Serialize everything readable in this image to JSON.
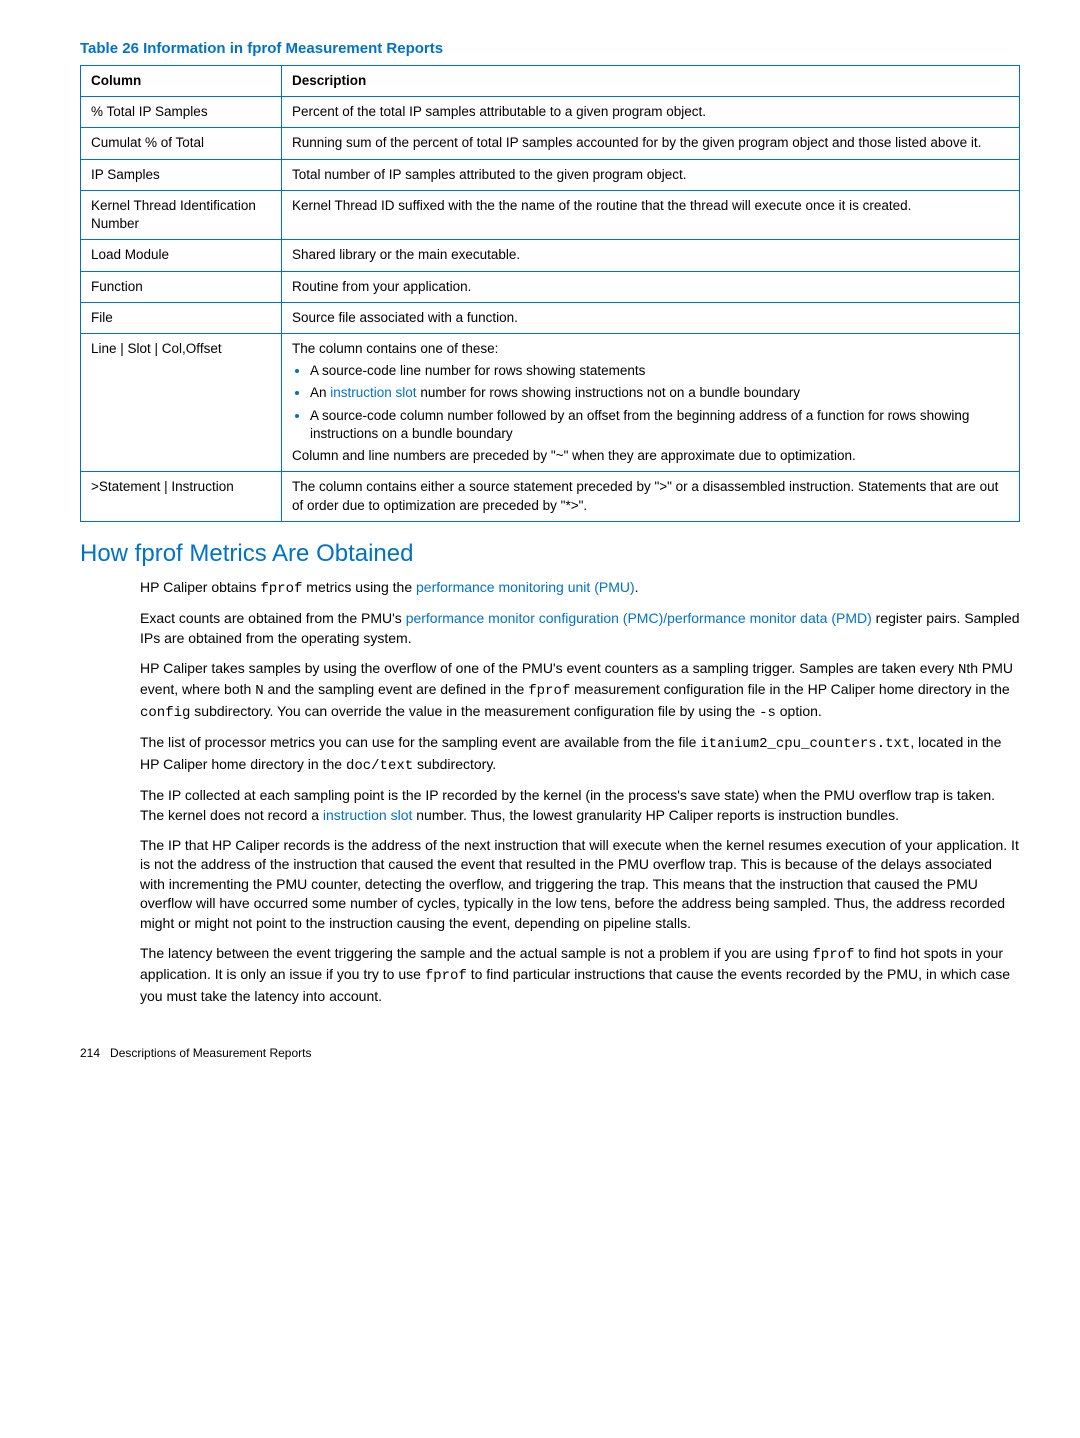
{
  "table": {
    "title": "Table 26 Information in fprof Measurement Reports",
    "headers": {
      "col1": "Column",
      "col2": "Description"
    },
    "rows": {
      "r1": {
        "c1": "% Total IP Samples",
        "c2": "Percent of the total IP samples attributable to a given program object."
      },
      "r2": {
        "c1": "Cumulat % of Total",
        "c2": "Running sum of the percent of total IP samples accounted for by the given program object and those listed above it."
      },
      "r3": {
        "c1": "IP Samples",
        "c2": "Total number of IP samples attributed to the given program object."
      },
      "r4": {
        "c1": "Kernel Thread Identification Number",
        "c2": "Kernel Thread ID suffixed with the the name of the routine that the thread will execute once it is created."
      },
      "r5": {
        "c1": "Load Module",
        "c2": "Shared library or the main executable."
      },
      "r6": {
        "c1": "Function",
        "c2": "Routine from your application."
      },
      "r7": {
        "c1": "File",
        "c2": "Source file associated with a function."
      },
      "r8": {
        "c1": "Line | Slot | Col,Offset",
        "intro": "The column contains one of these:",
        "b1": "A source-code line number for rows showing statements",
        "b2a": "An ",
        "b2link": "instruction slot",
        "b2b": " number for rows showing instructions not on a bundle boundary",
        "b3": "A source-code column number followed by an offset from the beginning address of a function for rows showing instructions on a bundle boundary",
        "outro": "Column and line numbers are preceded by \"~\" when they are approximate due to optimization."
      },
      "r9": {
        "c1": ">Statement | Instruction",
        "c2": "The column contains either a source statement preceded by \">\" or a disassembled instruction. Statements that are out of order due to optimization are preceded by \"*>\"."
      }
    }
  },
  "section": {
    "heading": "How fprof Metrics Are Obtained",
    "p1": {
      "a": "HP Caliper obtains ",
      "code": "fprof",
      "b": " metrics using the ",
      "link": "performance monitoring unit (PMU)",
      "c": "."
    },
    "p2": {
      "a": "Exact counts are obtained from the PMU's ",
      "link": "performance monitor configuration (PMC)/performance monitor data (PMD)",
      "b": " register pairs. Sampled IPs are obtained from the operating system."
    },
    "p3": {
      "a": "HP Caliper takes samples by using the overflow of one of the PMU's event counters as a sampling trigger. Samples are taken every ",
      "code1": "N",
      "b": "th PMU event, where both ",
      "code2": "N",
      "c": " and the sampling event are defined in the ",
      "code3": "fprof",
      "d": " measurement configuration file in the HP Caliper home directory in the ",
      "code4": "config",
      "e": " subdirectory. You can override the value in the measurement configuration file by using the ",
      "code5": "-s",
      "f": " option."
    },
    "p4": {
      "a": "The list of processor metrics you can use for the sampling event are available from the file ",
      "code1": "itanium2_cpu_counters.txt",
      "b": ", located in the HP Caliper home directory in the ",
      "code2": "doc/text",
      "c": " subdirectory."
    },
    "p5": {
      "a": "The IP collected at each sampling point is the IP recorded by the kernel (in the process's save state) when the PMU overflow trap is taken. The kernel does not record a ",
      "link": "instruction slot",
      "b": " number. Thus, the lowest granularity HP Caliper reports is instruction bundles."
    },
    "p6": "The IP that HP Caliper records is the address of the next instruction that will execute when the kernel resumes execution of your application. It is not the address of the instruction that caused the event that resulted in the PMU overflow trap. This is because of the delays associated with incrementing the PMU counter, detecting the overflow, and triggering the trap. This means that the instruction that caused the PMU overflow will have occurred some number of cycles, typically in the low tens, before the address being sampled. Thus, the address recorded might or might not point to the instruction causing the event, depending on pipeline stalls.",
    "p7": {
      "a": "The latency between the event triggering the sample and the actual sample is not a problem if you are using ",
      "code1": "fprof",
      "b": " to find hot spots in your application. It is only an issue if you try to use ",
      "code2": "fprof",
      "c": " to find particular instructions that cause the events recorded by the PMU, in which case you must take the latency into account."
    }
  },
  "footer": {
    "page": "214",
    "chapter": "Descriptions of Measurement Reports"
  }
}
